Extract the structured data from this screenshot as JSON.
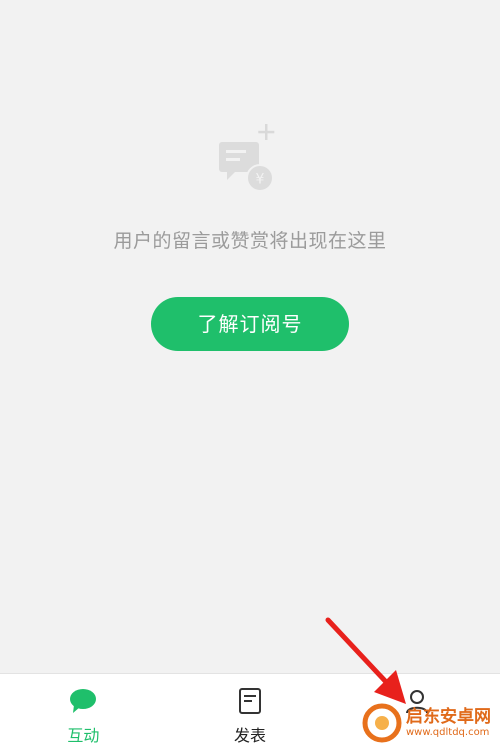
{
  "empty_state": {
    "icon": "message-reward-icon",
    "text": "用户的留言或赞赏将出现在这里",
    "button_label": "了解订阅号"
  },
  "tabbar": {
    "tabs": [
      {
        "label": "互动",
        "icon": "chat-bubble-icon",
        "active": true
      },
      {
        "label": "发表",
        "icon": "document-icon",
        "active": false
      },
      {
        "label": "",
        "icon": "user-icon",
        "active": false
      }
    ]
  },
  "watermark": {
    "title": "启东安卓网",
    "url": "www.qdltdq.com"
  },
  "colors": {
    "accent": "#1fbf6b",
    "background": "#f2f2f2",
    "annotation_arrow": "#e8211c"
  }
}
